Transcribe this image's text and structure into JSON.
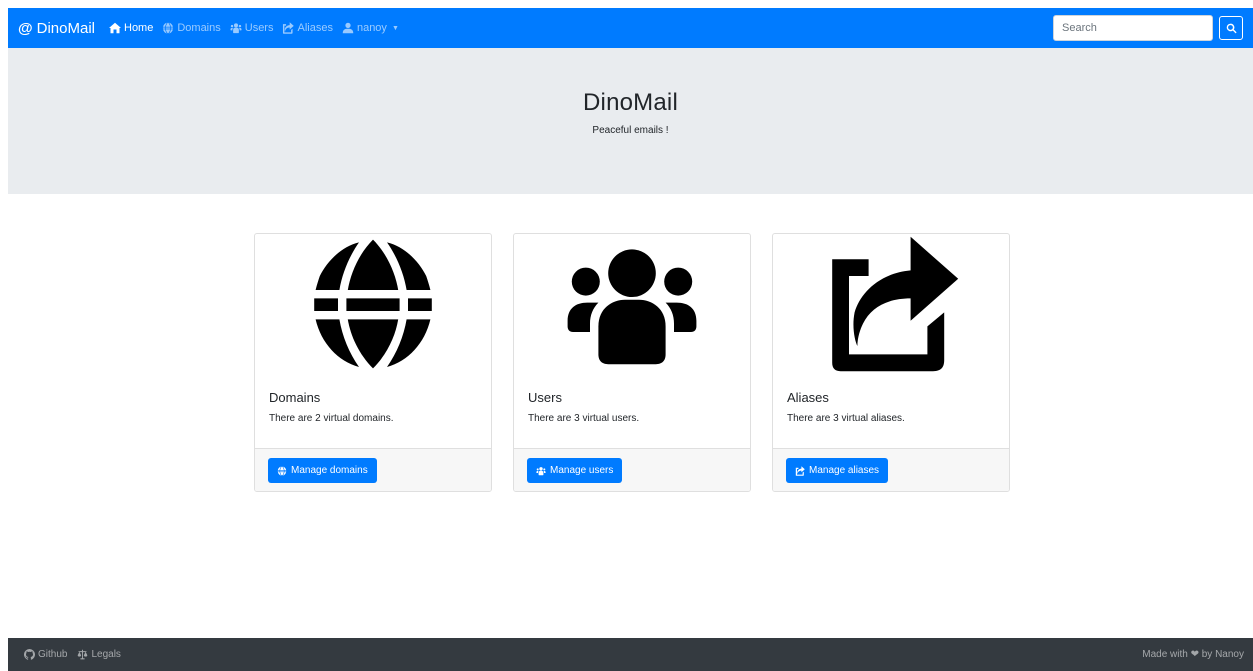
{
  "navbar": {
    "brand_symbol": "@",
    "brand": "DinoMail",
    "items": [
      {
        "label": "Home",
        "icon": "home-icon",
        "active": true
      },
      {
        "label": "Domains",
        "icon": "globe-icon"
      },
      {
        "label": "Users",
        "icon": "users-icon"
      },
      {
        "label": "Aliases",
        "icon": "share-icon"
      },
      {
        "label": "nanoy",
        "icon": "user-icon",
        "dropdown": true
      }
    ],
    "search_placeholder": "Search",
    "search_icon": "search-icon"
  },
  "jumbotron": {
    "title": "DinoMail",
    "subtitle": "Peaceful emails !"
  },
  "cards": [
    {
      "image": "globe-icon",
      "title": "Domains",
      "text": "There are 2 virtual domains.",
      "button": "Manage domains"
    },
    {
      "image": "users-icon",
      "title": "Users",
      "text": "There are 3 virtual users.",
      "button": "Manage users"
    },
    {
      "image": "share-icon",
      "title": "Aliases",
      "text": "There are 3 virtual aliases.",
      "button": "Manage aliases"
    }
  ],
  "footer": {
    "github": "Github",
    "legals": "Legals",
    "made_with": "Made with ❤ by Nanoy"
  },
  "colors": {
    "primary": "#007bff",
    "jumbotron_bg": "#e9ecef",
    "footer_bg": "#343a40"
  }
}
